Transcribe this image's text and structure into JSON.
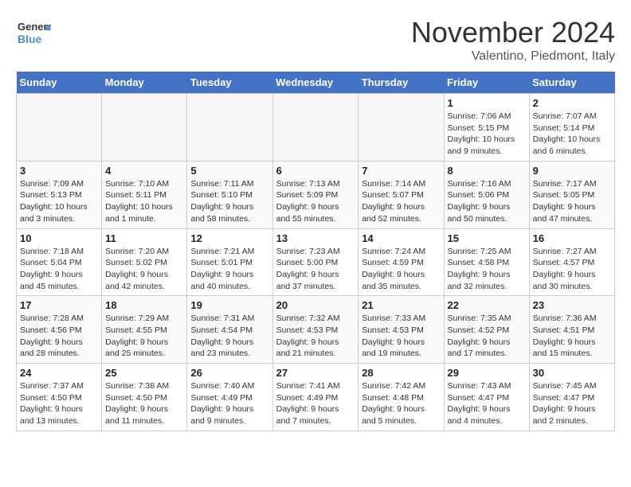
{
  "header": {
    "logo_line1": "General",
    "logo_line2": "Blue",
    "month": "November 2024",
    "location": "Valentino, Piedmont, Italy"
  },
  "weekdays": [
    "Sunday",
    "Monday",
    "Tuesday",
    "Wednesday",
    "Thursday",
    "Friday",
    "Saturday"
  ],
  "weeks": [
    [
      {
        "day": "",
        "info": ""
      },
      {
        "day": "",
        "info": ""
      },
      {
        "day": "",
        "info": ""
      },
      {
        "day": "",
        "info": ""
      },
      {
        "day": "",
        "info": ""
      },
      {
        "day": "1",
        "info": "Sunrise: 7:06 AM\nSunset: 5:15 PM\nDaylight: 10 hours\nand 9 minutes."
      },
      {
        "day": "2",
        "info": "Sunrise: 7:07 AM\nSunset: 5:14 PM\nDaylight: 10 hours\nand 6 minutes."
      }
    ],
    [
      {
        "day": "3",
        "info": "Sunrise: 7:09 AM\nSunset: 5:13 PM\nDaylight: 10 hours\nand 3 minutes."
      },
      {
        "day": "4",
        "info": "Sunrise: 7:10 AM\nSunset: 5:11 PM\nDaylight: 10 hours\nand 1 minute."
      },
      {
        "day": "5",
        "info": "Sunrise: 7:11 AM\nSunset: 5:10 PM\nDaylight: 9 hours\nand 58 minutes."
      },
      {
        "day": "6",
        "info": "Sunrise: 7:13 AM\nSunset: 5:09 PM\nDaylight: 9 hours\nand 55 minutes."
      },
      {
        "day": "7",
        "info": "Sunrise: 7:14 AM\nSunset: 5:07 PM\nDaylight: 9 hours\nand 52 minutes."
      },
      {
        "day": "8",
        "info": "Sunrise: 7:16 AM\nSunset: 5:06 PM\nDaylight: 9 hours\nand 50 minutes."
      },
      {
        "day": "9",
        "info": "Sunrise: 7:17 AM\nSunset: 5:05 PM\nDaylight: 9 hours\nand 47 minutes."
      }
    ],
    [
      {
        "day": "10",
        "info": "Sunrise: 7:18 AM\nSunset: 5:04 PM\nDaylight: 9 hours\nand 45 minutes."
      },
      {
        "day": "11",
        "info": "Sunrise: 7:20 AM\nSunset: 5:02 PM\nDaylight: 9 hours\nand 42 minutes."
      },
      {
        "day": "12",
        "info": "Sunrise: 7:21 AM\nSunset: 5:01 PM\nDaylight: 9 hours\nand 40 minutes."
      },
      {
        "day": "13",
        "info": "Sunrise: 7:23 AM\nSunset: 5:00 PM\nDaylight: 9 hours\nand 37 minutes."
      },
      {
        "day": "14",
        "info": "Sunrise: 7:24 AM\nSunset: 4:59 PM\nDaylight: 9 hours\nand 35 minutes."
      },
      {
        "day": "15",
        "info": "Sunrise: 7:25 AM\nSunset: 4:58 PM\nDaylight: 9 hours\nand 32 minutes."
      },
      {
        "day": "16",
        "info": "Sunrise: 7:27 AM\nSunset: 4:57 PM\nDaylight: 9 hours\nand 30 minutes."
      }
    ],
    [
      {
        "day": "17",
        "info": "Sunrise: 7:28 AM\nSunset: 4:56 PM\nDaylight: 9 hours\nand 28 minutes."
      },
      {
        "day": "18",
        "info": "Sunrise: 7:29 AM\nSunset: 4:55 PM\nDaylight: 9 hours\nand 25 minutes."
      },
      {
        "day": "19",
        "info": "Sunrise: 7:31 AM\nSunset: 4:54 PM\nDaylight: 9 hours\nand 23 minutes."
      },
      {
        "day": "20",
        "info": "Sunrise: 7:32 AM\nSunset: 4:53 PM\nDaylight: 9 hours\nand 21 minutes."
      },
      {
        "day": "21",
        "info": "Sunrise: 7:33 AM\nSunset: 4:53 PM\nDaylight: 9 hours\nand 19 minutes."
      },
      {
        "day": "22",
        "info": "Sunrise: 7:35 AM\nSunset: 4:52 PM\nDaylight: 9 hours\nand 17 minutes."
      },
      {
        "day": "23",
        "info": "Sunrise: 7:36 AM\nSunset: 4:51 PM\nDaylight: 9 hours\nand 15 minutes."
      }
    ],
    [
      {
        "day": "24",
        "info": "Sunrise: 7:37 AM\nSunset: 4:50 PM\nDaylight: 9 hours\nand 13 minutes."
      },
      {
        "day": "25",
        "info": "Sunrise: 7:38 AM\nSunset: 4:50 PM\nDaylight: 9 hours\nand 11 minutes."
      },
      {
        "day": "26",
        "info": "Sunrise: 7:40 AM\nSunset: 4:49 PM\nDaylight: 9 hours\nand 9 minutes."
      },
      {
        "day": "27",
        "info": "Sunrise: 7:41 AM\nSunset: 4:49 PM\nDaylight: 9 hours\nand 7 minutes."
      },
      {
        "day": "28",
        "info": "Sunrise: 7:42 AM\nSunset: 4:48 PM\nDaylight: 9 hours\nand 5 minutes."
      },
      {
        "day": "29",
        "info": "Sunrise: 7:43 AM\nSunset: 4:47 PM\nDaylight: 9 hours\nand 4 minutes."
      },
      {
        "day": "30",
        "info": "Sunrise: 7:45 AM\nSunset: 4:47 PM\nDaylight: 9 hours\nand 2 minutes."
      }
    ]
  ]
}
